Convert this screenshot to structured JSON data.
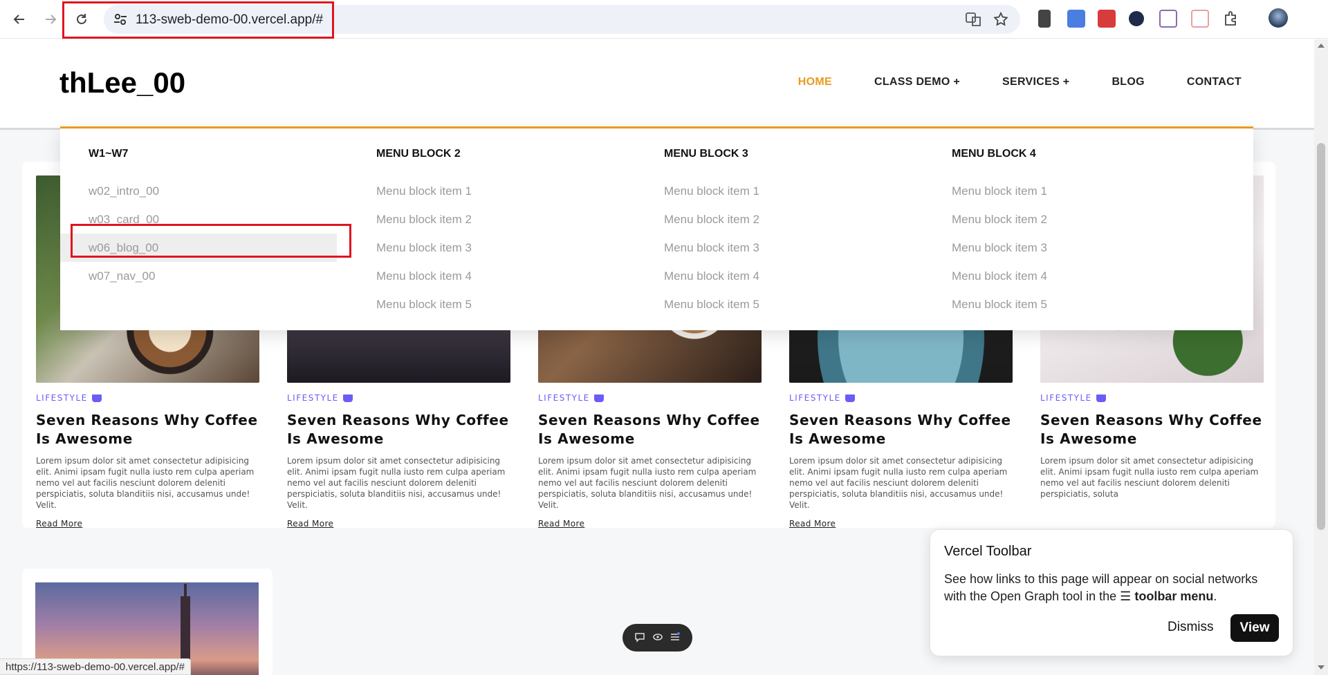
{
  "browser": {
    "url": "113-sweb-demo-00.vercel.app/#",
    "status_url": "https://113-sweb-demo-00.vercel.app/#"
  },
  "site": {
    "logo": "thLee_00",
    "nav": [
      "HOME",
      "CLASS DEMO +",
      "SERVICES +",
      "BLOG",
      "CONTACT"
    ],
    "active_nav": "HOME",
    "accent_color": "#e99b1b"
  },
  "mega_menu": {
    "columns": [
      {
        "title": "W1~W7",
        "items": [
          "w02_intro_00",
          "w03_card_00",
          "w06_blog_00",
          "w07_nav_00"
        ]
      },
      {
        "title": "MENU BLOCK 2",
        "items": [
          "Menu block item 1",
          "Menu block item 2",
          "Menu block item 3",
          "Menu block item 4",
          "Menu block item 5"
        ]
      },
      {
        "title": "MENU BLOCK 3",
        "items": [
          "Menu block item 1",
          "Menu block item 2",
          "Menu block item 3",
          "Menu block item 4",
          "Menu block item 5"
        ]
      },
      {
        "title": "MENU BLOCK 4",
        "items": [
          "Menu block item 1",
          "Menu block item 2",
          "Menu block item 3",
          "Menu block item 4",
          "Menu block item 5"
        ]
      }
    ],
    "hovered_item": "w06_blog_00"
  },
  "cards": [
    {
      "category": "LIFESTYLE",
      "title": "Seven Reasons Why Coffee Is Awesome",
      "body": "Lorem ipsum dolor sit amet consectetur adipisicing elit. Animi ipsam fugit nulla iusto rem culpa aperiam nemo vel aut facilis nesciunt dolorem deleniti perspiciatis, soluta blanditiis nisi, accusamus unde! Velit.",
      "link": "Read More"
    },
    {
      "category": "LIFESTYLE",
      "title": "Seven Reasons Why Coffee Is Awesome",
      "body": "Lorem ipsum dolor sit amet consectetur adipisicing elit. Animi ipsam fugit nulla iusto rem culpa aperiam nemo vel aut facilis nesciunt dolorem deleniti perspiciatis, soluta blanditiis nisi, accusamus unde! Velit.",
      "link": "Read More"
    },
    {
      "category": "LIFESTYLE",
      "title": "Seven Reasons Why Coffee Is Awesome",
      "body": "Lorem ipsum dolor sit amet consectetur adipisicing elit. Animi ipsam fugit nulla iusto rem culpa aperiam nemo vel aut facilis nesciunt dolorem deleniti perspiciatis, soluta blanditiis nisi, accusamus unde! Velit.",
      "link": "Read More"
    },
    {
      "category": "LIFESTYLE",
      "title": "Seven Reasons Why Coffee Is Awesome",
      "body": "Lorem ipsum dolor sit amet consectetur adipisicing elit. Animi ipsam fugit nulla iusto rem culpa aperiam nemo vel aut facilis nesciunt dolorem deleniti perspiciatis, soluta blanditiis nisi, accusamus unde! Velit.",
      "link": "Read More"
    },
    {
      "category": "LIFESTYLE",
      "title": "Seven Reasons Why Coffee Is Awesome",
      "body": "Lorem ipsum dolor sit amet consectetur adipisicing elit. Animi ipsam fugit nulla iusto rem culpa aperiam nemo vel aut facilis nesciunt dolorem deleniti perspiciatis, soluta",
      "link": ""
    }
  ],
  "vercel_popup": {
    "title": "Vercel Toolbar",
    "text_before": "See how links to this page will appear on social networks with the Open Graph tool in the",
    "text_bold": "toolbar menu",
    "text_after": ".",
    "dismiss": "Dismiss",
    "view": "View"
  },
  "icons": [
    "back-icon",
    "forward-icon",
    "reload-icon",
    "site-settings-icon",
    "translate-icon",
    "star-icon",
    "extensions-icon",
    "profile-avatar",
    "comment-icon",
    "eye-icon",
    "menu-icon"
  ]
}
